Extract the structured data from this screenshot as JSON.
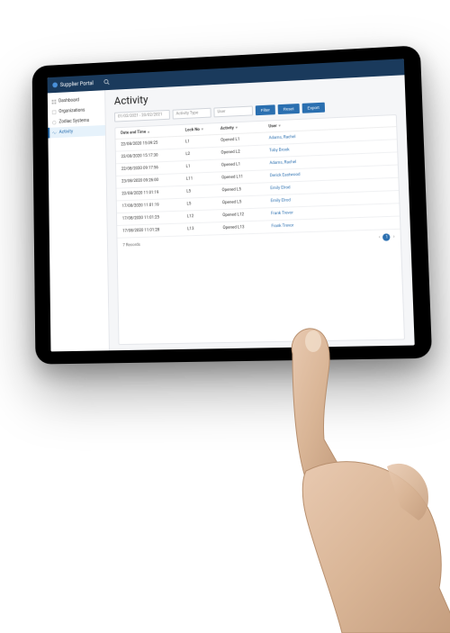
{
  "topbar": {
    "title": "Supplier Portal"
  },
  "sidebar": {
    "items": [
      {
        "label": "Dashboard",
        "icon": "dashboard"
      },
      {
        "label": "Organizations",
        "icon": "org"
      },
      {
        "label": "Zodiac Systems",
        "icon": "system"
      },
      {
        "label": "Activity",
        "icon": "activity"
      }
    ]
  },
  "page": {
    "title": "Activity",
    "filters": {
      "date_range": "01/02/2021 - 20/02/2021",
      "activity_type_placeholder": "Activity Type",
      "user_placeholder": "User",
      "filter_btn": "Filter",
      "reset_btn": "Reset",
      "export_btn": "Export"
    },
    "table": {
      "headers": {
        "datetime": "Date and Time",
        "lock": "Lock No",
        "activity": "Activity",
        "user": "User"
      },
      "rows": [
        {
          "dt": "22/08/2020 15:09:25",
          "lock": "L1",
          "act": "Opened L1",
          "user": "Adams, Rachel"
        },
        {
          "dt": "22/08/2020 15:17:30",
          "lock": "L2",
          "act": "Opened L2",
          "user": "Toby Brook"
        },
        {
          "dt": "22/08/2020 09:17:56",
          "lock": "L1",
          "act": "Opened L1",
          "user": "Adams, Rachel"
        },
        {
          "dt": "23/08/2020 09:26:00",
          "lock": "L11",
          "act": "Opened L11",
          "user": "Derick Eastwood"
        },
        {
          "dt": "22/08/2020 11:01:19",
          "lock": "L5",
          "act": "Opened L5",
          "user": "Emily Elrod"
        },
        {
          "dt": "17/08/2020 11:01:19",
          "lock": "L5",
          "act": "Opened L5",
          "user": "Emily Elrod"
        },
        {
          "dt": "17/08/2020 11:01:25",
          "lock": "L12",
          "act": "Opened L12",
          "user": "Frank Trevor"
        },
        {
          "dt": "17/08/2020 11:01:28",
          "lock": "L13",
          "act": "Opened L13",
          "user": "Frank Trevor"
        }
      ],
      "footer": {
        "records": "7 Records",
        "page": "1"
      }
    }
  }
}
